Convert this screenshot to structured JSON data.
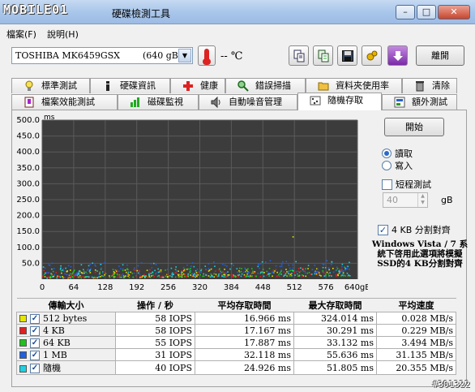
{
  "window": {
    "logo": "MOBILE01",
    "title": "硬碟檢測工具",
    "min": "–",
    "max": "□",
    "close": "✕"
  },
  "menu": [
    {
      "label": "檔案(F)"
    },
    {
      "label": "說明(H)"
    }
  ],
  "toolbar": {
    "drive": "TOSHIBA MK6459GSX        (640 gB)",
    "temperature": "-- ℃",
    "exit_label": "離開",
    "icons": [
      "copy-icon",
      "copy-text-icon",
      "save-icon",
      "options-icon",
      "download-icon"
    ]
  },
  "tabs_row1": [
    {
      "label": "標準測試",
      "icon": "bulb-icon"
    },
    {
      "label": "硬碟資訊",
      "icon": "info-icon"
    },
    {
      "label": "健康",
      "icon": "health-cross-icon"
    },
    {
      "label": "錯誤掃描",
      "icon": "magnifier-icon"
    },
    {
      "label": "資料夾使用率",
      "icon": "folder-icon"
    },
    {
      "label": "清除",
      "icon": "trash-icon"
    }
  ],
  "tabs_row2": [
    {
      "label": "檔案效能測試",
      "icon": "file-bench-icon"
    },
    {
      "label": "磁碟監視",
      "icon": "monitor-chart-icon"
    },
    {
      "label": "自動噪音管理",
      "icon": "speaker-icon"
    },
    {
      "label": "隨機存取",
      "icon": "random-access-icon",
      "active": true
    },
    {
      "label": "額外測試",
      "icon": "extra-test-icon"
    }
  ],
  "controls": {
    "start_label": "開始",
    "read_label": "讀取",
    "write_label": "寫入",
    "short_test_label": "短程測試",
    "short_test_value": "40",
    "gb_label": "gB",
    "align_label": "4 KB 分割對齊",
    "note": "Windows Vista / 7 系統下啓用此選項將模擬SSD的4 KB分割對齊"
  },
  "chart_data": {
    "type": "scatter",
    "ylabel": "ms",
    "xlabel": "gB",
    "yticks": [
      "500.0",
      "450.0",
      "400.0",
      "350.0",
      "300.0",
      "250.0",
      "200.0",
      "150.0",
      "100.0",
      "50.0"
    ],
    "xticks": [
      "0",
      "64",
      "128",
      "192",
      "256",
      "320",
      "384",
      "448",
      "512",
      "576",
      "640gB"
    ],
    "ylim": [
      0,
      500
    ],
    "xlim": [
      0,
      640
    ],
    "grid": true,
    "background": "#3c3c3c",
    "series": [
      {
        "name": "512 bytes",
        "color": "#e6e600",
        "typical_ms": [
          5,
          30
        ]
      },
      {
        "name": "4 KB",
        "color": "#e02020",
        "typical_ms": [
          5,
          30
        ]
      },
      {
        "name": "64 KB",
        "color": "#20c020",
        "typical_ms": [
          5,
          33
        ]
      },
      {
        "name": "1 MB",
        "color": "#2060e0",
        "typical_ms": [
          15,
          56
        ]
      },
      {
        "name": "隨機",
        "color": "#20d0e0",
        "typical_ms": [
          5,
          52
        ]
      }
    ]
  },
  "results": {
    "headers": [
      "傳輸大小",
      "操作 / 秒",
      "平均存取時間",
      "最大存取時間",
      "平均速度"
    ],
    "rows": [
      {
        "label": "512 bytes",
        "color": "#e6e600",
        "iops": "58 IOPS",
        "avg": "16.966 ms",
        "max": "324.014 ms",
        "speed": "0.028 MB/s"
      },
      {
        "label": "4 KB",
        "color": "#e02020",
        "iops": "58 IOPS",
        "avg": "17.167 ms",
        "max": "30.291 ms",
        "speed": "0.229 MB/s"
      },
      {
        "label": "64 KB",
        "color": "#20c020",
        "iops": "55 IOPS",
        "avg": "17.887 ms",
        "max": "33.132 ms",
        "speed": "3.494 MB/s"
      },
      {
        "label": "1 MB",
        "color": "#2060e0",
        "iops": "31 IOPS",
        "avg": "32.118 ms",
        "max": "55.636 ms",
        "speed": "31.135 MB/s"
      },
      {
        "label": "隨機",
        "color": "#20d0e0",
        "iops": "40 IOPS",
        "avg": "24.926 ms",
        "max": "51.805 ms",
        "speed": "20.355 MB/s"
      }
    ]
  },
  "watermark": "#301322"
}
